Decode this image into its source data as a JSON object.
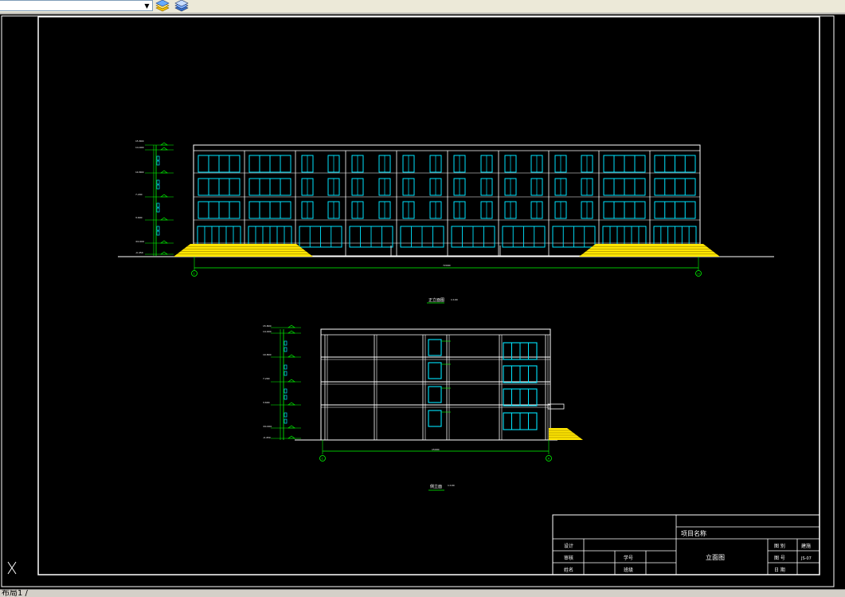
{
  "toolbar": {
    "layer_value": "",
    "buttons": [
      {
        "name": "layer-manager-icon"
      },
      {
        "name": "layer-states-icon"
      }
    ]
  },
  "drawing": {
    "front_elevation_title": "正立面图",
    "front_elevation_scale": "1:100",
    "side_elevation_title": "侧立面",
    "side_elevation_scale": "1:100",
    "front_total_dimension": "72000",
    "side_total_dimension": "15000",
    "front_axis_start": "1",
    "front_axis_end": "14",
    "side_axis_start": "C",
    "side_axis_end": "A",
    "front_levels": [
      "15.800",
      "14.400",
      "10.800",
      "7.200",
      "3.600",
      "±0.000",
      "-0.450"
    ],
    "side_levels": [
      "15.800",
      "14.400",
      "10.800",
      "7.200",
      "3.600",
      "±0.000",
      "-0.450"
    ]
  },
  "title_block": {
    "project_name_label": "项目名称",
    "drawing_name": "立面图",
    "designer_label": "设计",
    "checker_label": "审核",
    "name_label": "姓名",
    "student_no_label": "学号",
    "class_label": "班级",
    "sheet_label": "图 别",
    "sheet_value": "建施",
    "number_label": "图 号",
    "number_value": "JS-07",
    "date_label": "日 期"
  },
  "tabs": {
    "layout": "布局1 /"
  },
  "colors": {
    "background": "#000000",
    "line_white": "#ffffff",
    "window_cyan": "#00e5ff",
    "dimension_green": "#00ff00",
    "steps_yellow": "#ffe600"
  }
}
